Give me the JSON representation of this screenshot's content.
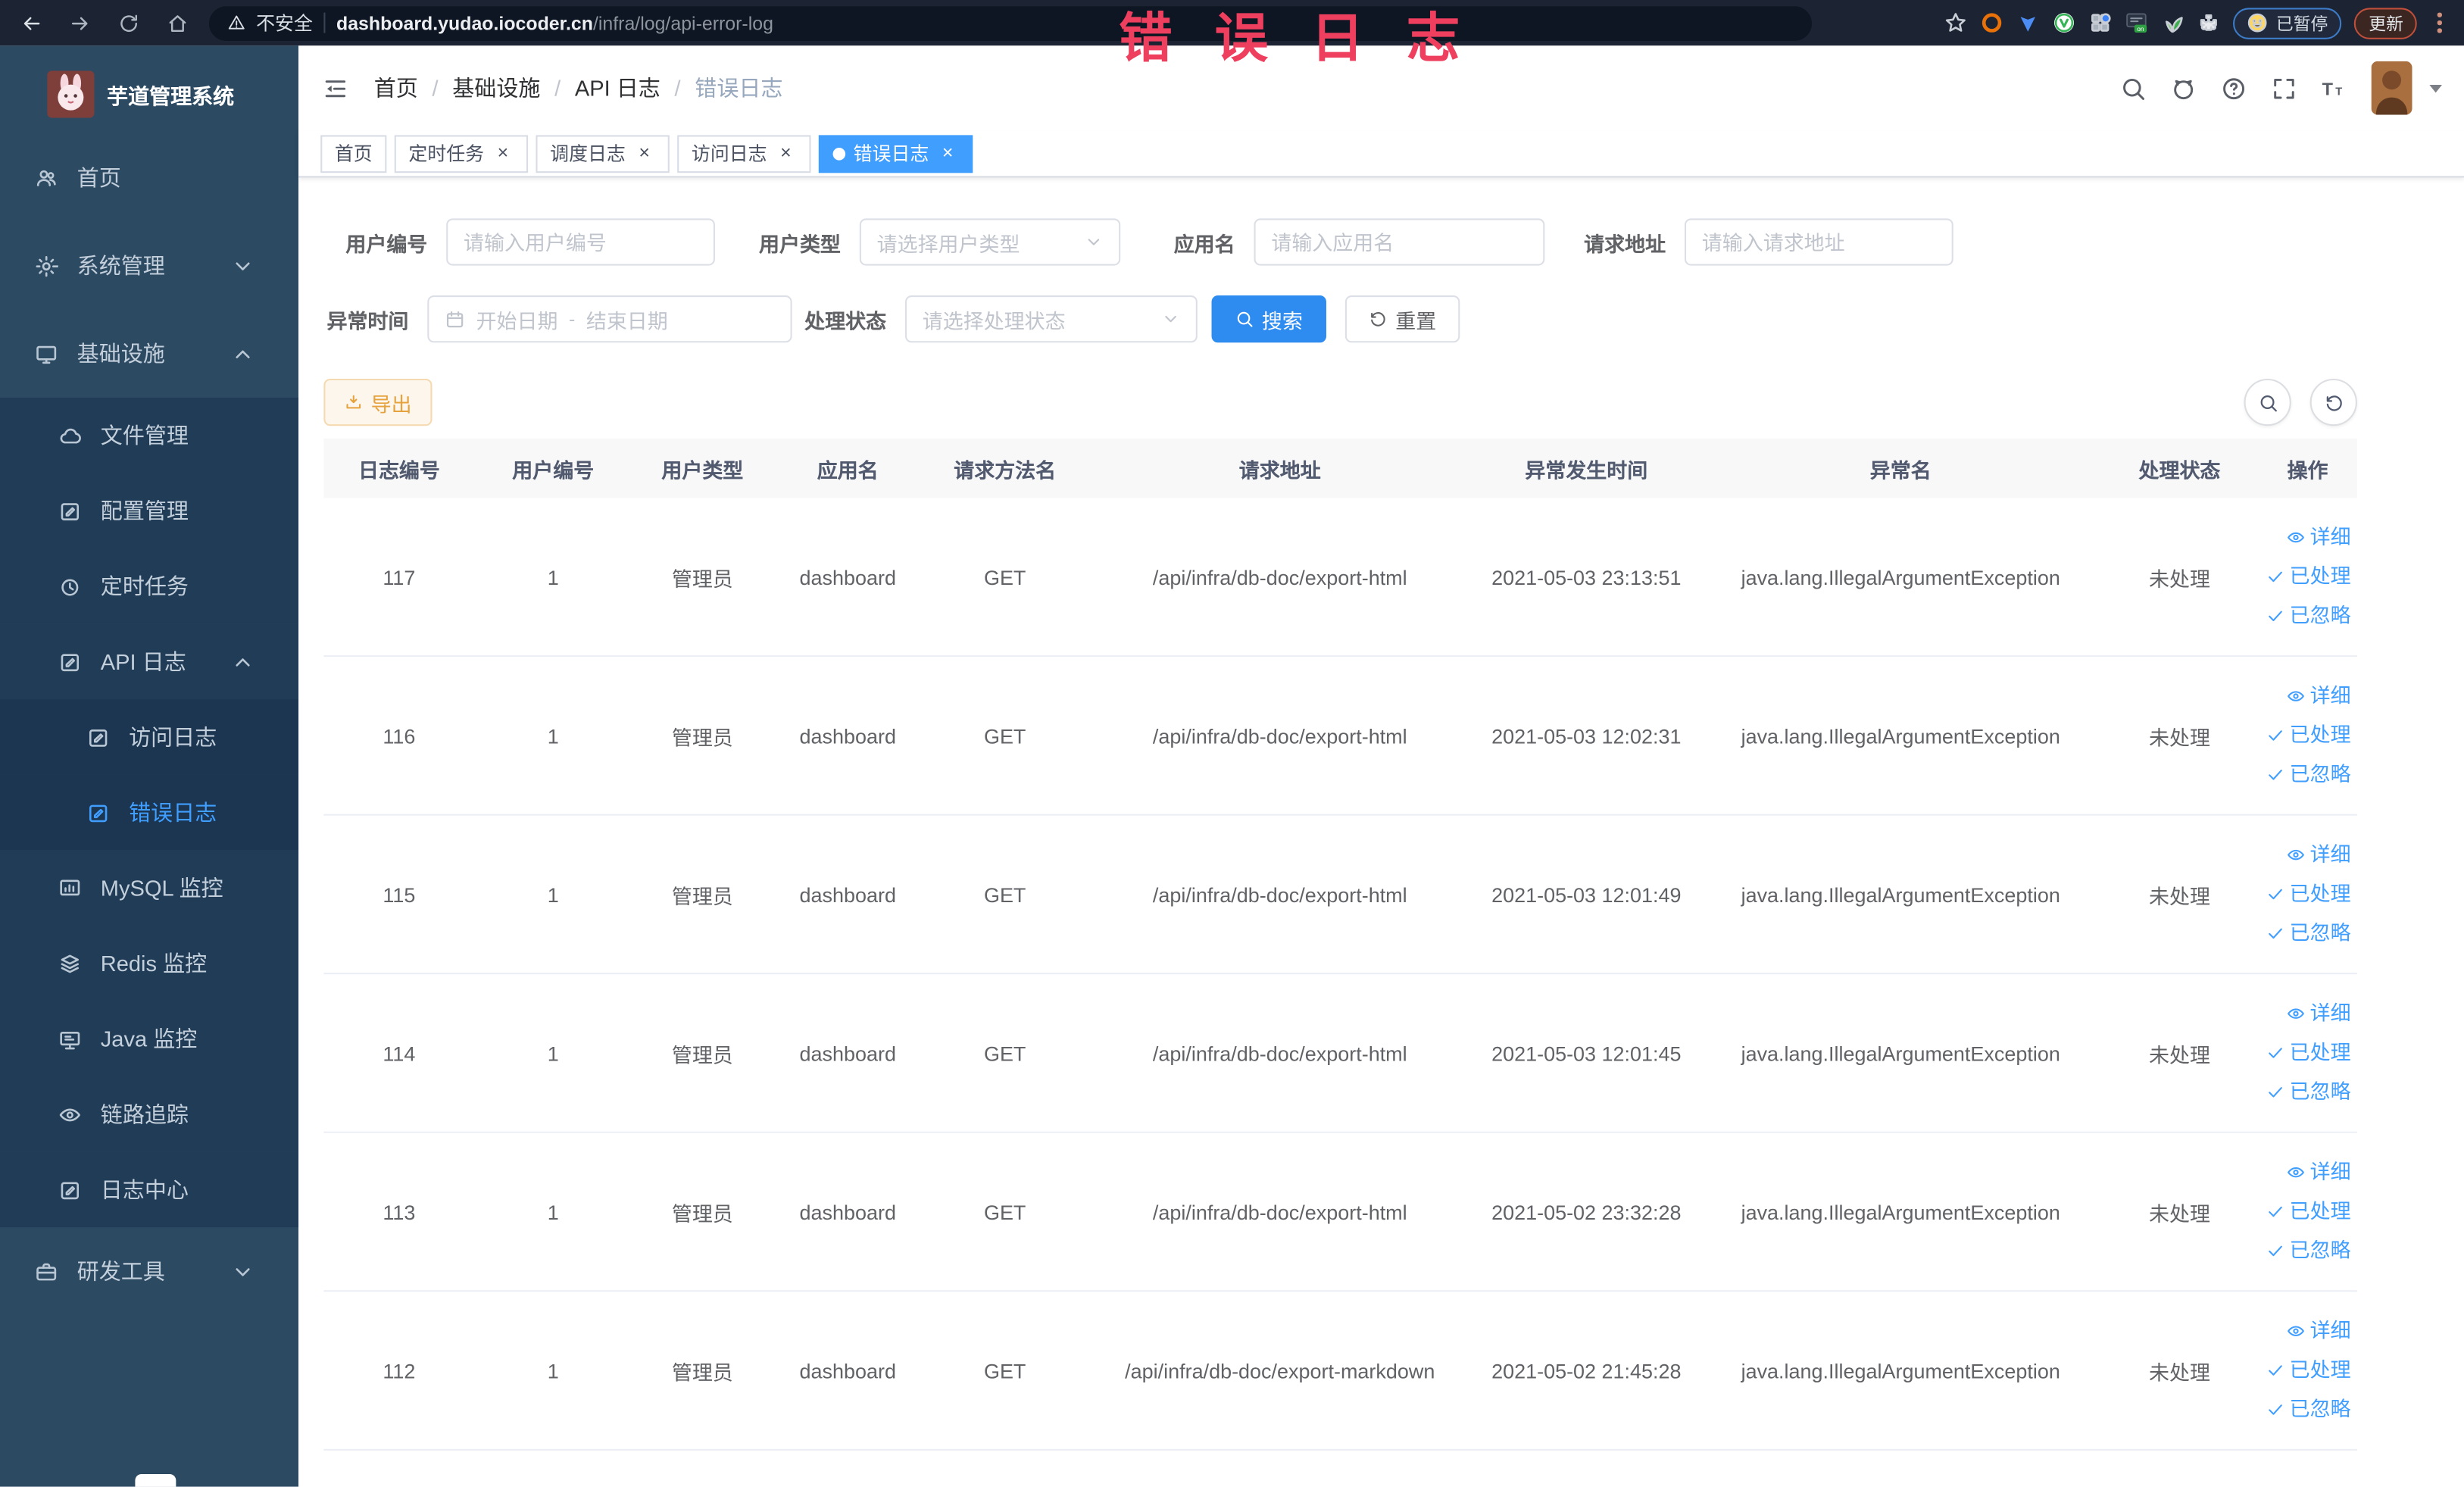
{
  "colors": {
    "accent": "#409eff",
    "primary_button": "#2e8cf0",
    "warning": "#e6a23c",
    "watermark": "#ee3f5f"
  },
  "browser": {
    "security_label": "不安全",
    "url_host": "dashboard.yudao.iocoder.cn",
    "url_path": "/infra/log/api-error-log",
    "paused_label": "已暂停",
    "update_label": "更新"
  },
  "watermark": {
    "text": "错误日志"
  },
  "sidebar": {
    "title": "芋道管理系统",
    "menu": [
      {
        "label": "首页",
        "icon": "people",
        "level": 1
      },
      {
        "label": "系统管理",
        "icon": "gear",
        "level": 1,
        "chevron": "down"
      },
      {
        "label": "基础设施",
        "icon": "monitor",
        "level": 1,
        "chevron": "up"
      },
      {
        "label": "文件管理",
        "icon": "cloud",
        "level": 2
      },
      {
        "label": "配置管理",
        "icon": "editsq",
        "level": 2
      },
      {
        "label": "定时任务",
        "icon": "clock",
        "level": 2
      },
      {
        "label": "API 日志",
        "icon": "editsq",
        "level": 2,
        "chevron": "up"
      },
      {
        "label": "访问日志",
        "icon": "editsq",
        "level": 3
      },
      {
        "label": "错误日志",
        "icon": "editsq",
        "level": 3,
        "active": true
      },
      {
        "label": "MySQL 监控",
        "icon": "chart",
        "level": 2
      },
      {
        "label": "Redis 监控",
        "icon": "stack",
        "level": 2
      },
      {
        "label": "Java 监控",
        "icon": "java",
        "level": 2
      },
      {
        "label": "链路追踪",
        "icon": "eye",
        "level": 2
      },
      {
        "label": "日志中心",
        "icon": "editsq",
        "level": 2
      },
      {
        "label": "研发工具",
        "icon": "case",
        "level": 1,
        "chevron": "down"
      }
    ]
  },
  "breadcrumb": {
    "separator": "/",
    "items": [
      "首页",
      "基础设施",
      "API 日志",
      "错误日志"
    ]
  },
  "tabs": {
    "items": [
      {
        "label": "首页",
        "closable": false,
        "active": false
      },
      {
        "label": "定时任务",
        "closable": true,
        "active": false
      },
      {
        "label": "调度日志",
        "closable": true,
        "active": false
      },
      {
        "label": "访问日志",
        "closable": true,
        "active": false
      },
      {
        "label": "错误日志",
        "closable": true,
        "active": true
      }
    ]
  },
  "filters": {
    "user_id": {
      "label": "用户编号",
      "placeholder": "请输入用户编号"
    },
    "user_type": {
      "label": "用户类型",
      "placeholder": "请选择用户类型"
    },
    "app_name": {
      "label": "应用名",
      "placeholder": "请输入应用名"
    },
    "request_url": {
      "label": "请求地址",
      "placeholder": "请输入请求地址"
    },
    "exception_time": {
      "label": "异常时间",
      "start_placeholder": "开始日期",
      "separator": "-",
      "end_placeholder": "结束日期"
    },
    "process_status": {
      "label": "处理状态",
      "placeholder": "请选择处理状态"
    },
    "search_label": "搜索",
    "reset_label": "重置"
  },
  "toolbar": {
    "export_label": "导出"
  },
  "table": {
    "columns": [
      {
        "key": "id",
        "label": "日志编号"
      },
      {
        "key": "user_id",
        "label": "用户编号"
      },
      {
        "key": "user_type",
        "label": "用户类型"
      },
      {
        "key": "app_name",
        "label": "应用名"
      },
      {
        "key": "method",
        "label": "请求方法名"
      },
      {
        "key": "url",
        "label": "请求地址"
      },
      {
        "key": "time",
        "label": "异常发生时间"
      },
      {
        "key": "exception",
        "label": "异常名"
      },
      {
        "key": "status",
        "label": "处理状态"
      },
      {
        "key": "actions",
        "label": "操作"
      }
    ],
    "rows": [
      {
        "id": "117",
        "user_id": "1",
        "user_type": "管理员",
        "app_name": "dashboard",
        "method": "GET",
        "url": "/api/infra/db-doc/export-html",
        "time": "2021-05-03 23:13:51",
        "exception": "java.lang.IllegalArgumentException",
        "status": "未处理"
      },
      {
        "id": "116",
        "user_id": "1",
        "user_type": "管理员",
        "app_name": "dashboard",
        "method": "GET",
        "url": "/api/infra/db-doc/export-html",
        "time": "2021-05-03 12:02:31",
        "exception": "java.lang.IllegalArgumentException",
        "status": "未处理"
      },
      {
        "id": "115",
        "user_id": "1",
        "user_type": "管理员",
        "app_name": "dashboard",
        "method": "GET",
        "url": "/api/infra/db-doc/export-html",
        "time": "2021-05-03 12:01:49",
        "exception": "java.lang.IllegalArgumentException",
        "status": "未处理"
      },
      {
        "id": "114",
        "user_id": "1",
        "user_type": "管理员",
        "app_name": "dashboard",
        "method": "GET",
        "url": "/api/infra/db-doc/export-html",
        "time": "2021-05-03 12:01:45",
        "exception": "java.lang.IllegalArgumentException",
        "status": "未处理"
      },
      {
        "id": "113",
        "user_id": "1",
        "user_type": "管理员",
        "app_name": "dashboard",
        "method": "GET",
        "url": "/api/infra/db-doc/export-html",
        "time": "2021-05-02 23:32:28",
        "exception": "java.lang.IllegalArgumentException",
        "status": "未处理"
      },
      {
        "id": "112",
        "user_id": "1",
        "user_type": "管理员",
        "app_name": "dashboard",
        "method": "GET",
        "url": "/api/infra/db-doc/export-markdown",
        "time": "2021-05-02 21:45:28",
        "exception": "java.lang.IllegalArgumentException",
        "status": "未处理"
      }
    ],
    "row_actions": [
      {
        "label": "详细",
        "icon": "eye"
      },
      {
        "label": "已处理",
        "icon": "check"
      },
      {
        "label": "已忽略",
        "icon": "check"
      }
    ]
  }
}
